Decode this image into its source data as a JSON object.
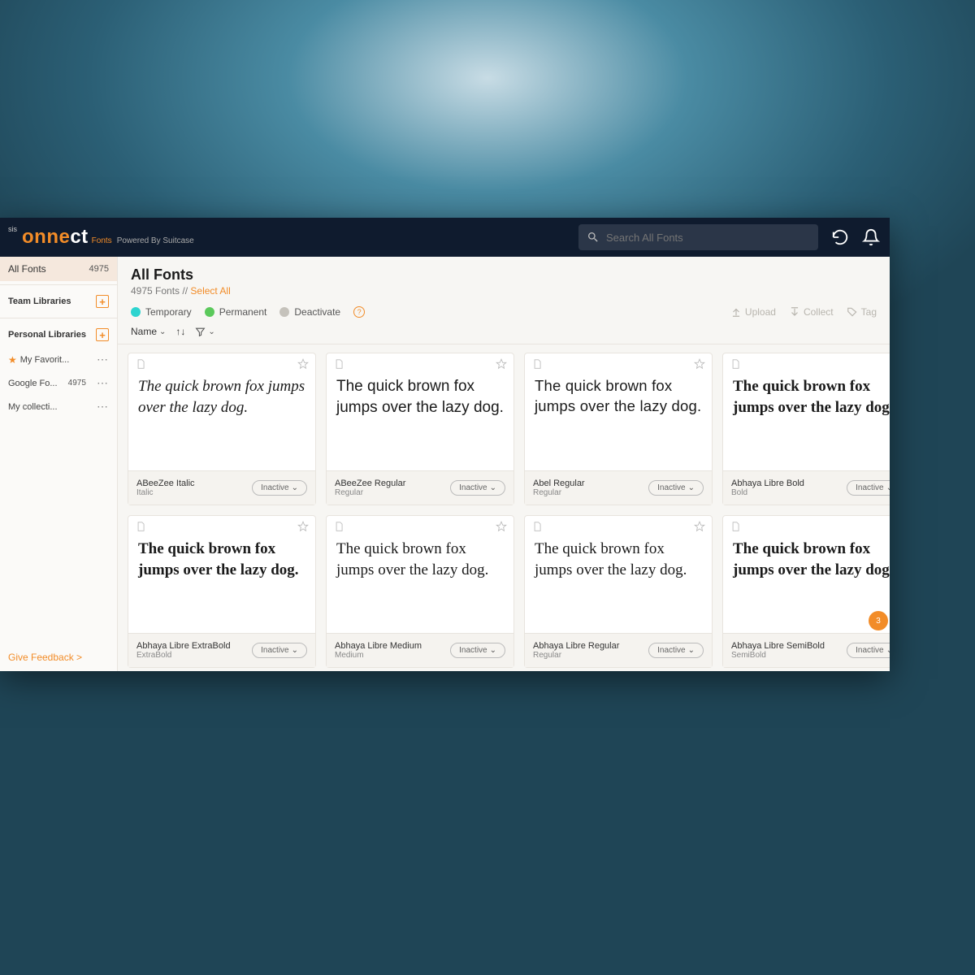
{
  "brand": {
    "prefix": "sis",
    "name_part1": "onne",
    "name_part2": "ct",
    "tagline1": "Fonts",
    "tagline2": "Powered By Suitcase"
  },
  "search": {
    "placeholder": "Search All Fonts"
  },
  "sidebar": {
    "all_fonts": {
      "label": "All Fonts",
      "count": "4975"
    },
    "team_header": "Team Libraries",
    "personal_header": "Personal Libraries",
    "libs": [
      {
        "name": "My Favorit...",
        "count": "",
        "starred": true
      },
      {
        "name": "Google Fo...",
        "count": "4975",
        "starred": false
      },
      {
        "name": "My collecti...",
        "count": "",
        "starred": false
      }
    ],
    "feedback": "Give Feedback >"
  },
  "main": {
    "title": "All Fonts",
    "count_label": "4975 Fonts // ",
    "select_all": "Select All",
    "legend": {
      "temporary": "Temporary",
      "permanent": "Permanent",
      "deactivate": "Deactivate"
    },
    "actions": {
      "upload": "Upload",
      "collect": "Collect",
      "tag": "Tag"
    },
    "sort": {
      "name": "Name"
    }
  },
  "preview_text": "The quick brown fox jumps over the lazy dog.",
  "fonts": [
    {
      "name": "ABeeZee Italic",
      "style": "Italic",
      "status": "Inactive",
      "cls": "italic"
    },
    {
      "name": "ABeeZee Regular",
      "style": "Regular",
      "status": "Inactive",
      "cls": "abee-reg"
    },
    {
      "name": "Abel Regular",
      "style": "Regular",
      "status": "Inactive",
      "cls": "abel"
    },
    {
      "name": "Abhaya Libre Bold",
      "style": "Bold",
      "status": "Inactive",
      "cls": "abhaya-bold"
    },
    {
      "name": "Abhaya Libre ExtraBold",
      "style": "ExtraBold",
      "status": "Inactive",
      "cls": "abhaya-extra"
    },
    {
      "name": "Abhaya Libre Medium",
      "style": "Medium",
      "status": "Inactive",
      "cls": "abhaya-med"
    },
    {
      "name": "Abhaya Libre Regular",
      "style": "Regular",
      "status": "Inactive",
      "cls": "abhaya-reg"
    },
    {
      "name": "Abhaya Libre SemiBold",
      "style": "SemiBold",
      "status": "Inactive",
      "cls": "abhaya-semi"
    }
  ],
  "badge": "3"
}
